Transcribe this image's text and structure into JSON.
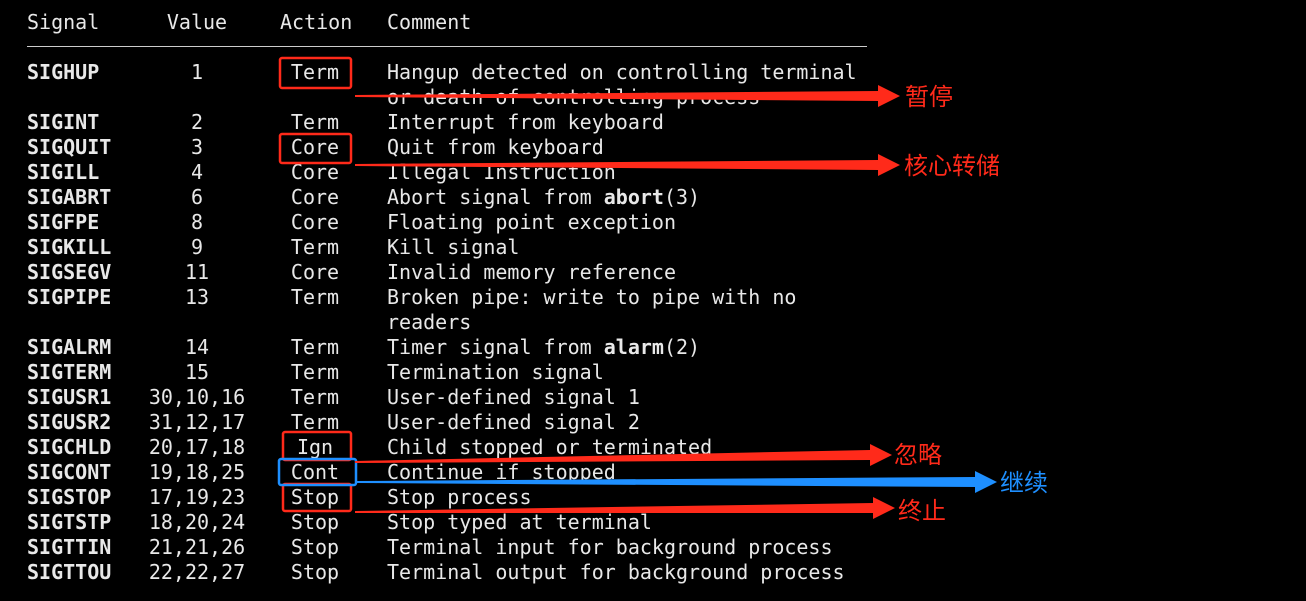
{
  "headers": {
    "signal": "Signal",
    "value": "Value",
    "action": "Action",
    "comment": "Comment"
  },
  "rows": [
    {
      "signal": "SIGHUP",
      "value": "1",
      "action": "Term",
      "comment": [
        "Hangup detected on controlling terminal",
        "or death of controlling process"
      ]
    },
    {
      "signal": "SIGINT",
      "value": "2",
      "action": "Term",
      "comment": [
        "Interrupt from keyboard"
      ]
    },
    {
      "signal": "SIGQUIT",
      "value": "3",
      "action": "Core",
      "comment": [
        "Quit from keyboard"
      ]
    },
    {
      "signal": "SIGILL",
      "value": "4",
      "action": "Core",
      "comment": [
        "Illegal Instruction"
      ]
    },
    {
      "signal": "SIGABRT",
      "value": "6",
      "action": "Core",
      "comment": [
        "Abort signal from |abort|(3)"
      ]
    },
    {
      "signal": "SIGFPE",
      "value": "8",
      "action": "Core",
      "comment": [
        "Floating point exception"
      ]
    },
    {
      "signal": "SIGKILL",
      "value": "9",
      "action": "Term",
      "comment": [
        "Kill signal"
      ]
    },
    {
      "signal": "SIGSEGV",
      "value": "11",
      "action": "Core",
      "comment": [
        "Invalid memory reference"
      ]
    },
    {
      "signal": "SIGPIPE",
      "value": "13",
      "action": "Term",
      "comment": [
        "Broken pipe: write to pipe with no",
        "readers"
      ]
    },
    {
      "signal": "SIGALRM",
      "value": "14",
      "action": "Term",
      "comment": [
        "Timer signal from |alarm|(2)"
      ]
    },
    {
      "signal": "SIGTERM",
      "value": "15",
      "action": "Term",
      "comment": [
        "Termination signal"
      ]
    },
    {
      "signal": "SIGUSR1",
      "value": "30,10,16",
      "action": "Term",
      "comment": [
        "User-defined signal 1"
      ]
    },
    {
      "signal": "SIGUSR2",
      "value": "31,12,17",
      "action": "Term",
      "comment": [
        "User-defined signal 2"
      ]
    },
    {
      "signal": "SIGCHLD",
      "value": "20,17,18",
      "action": "Ign",
      "comment": [
        "Child stopped or terminated"
      ]
    },
    {
      "signal": "SIGCONT",
      "value": "19,18,25",
      "action": "Cont",
      "comment": [
        "Continue if stopped"
      ]
    },
    {
      "signal": "SIGSTOP",
      "value": "17,19,23",
      "action": "Stop",
      "comment": [
        "Stop process"
      ]
    },
    {
      "signal": "SIGTSTP",
      "value": "18,20,24",
      "action": "Stop",
      "comment": [
        "Stop typed at terminal"
      ]
    },
    {
      "signal": "SIGTTIN",
      "value": "21,21,26",
      "action": "Stop",
      "comment": [
        "Terminal input for background process"
      ]
    },
    {
      "signal": "SIGTTOU",
      "value": "22,22,27",
      "action": "Stop",
      "comment": [
        "Terminal output for background process"
      ]
    }
  ],
  "annotations": {
    "term": "暂停",
    "core": "核心转储",
    "ign": "忽略",
    "cont": "继续",
    "stop": "终止",
    "colors": {
      "red": "#ff2a1a",
      "blue": "#1e8fff"
    }
  }
}
